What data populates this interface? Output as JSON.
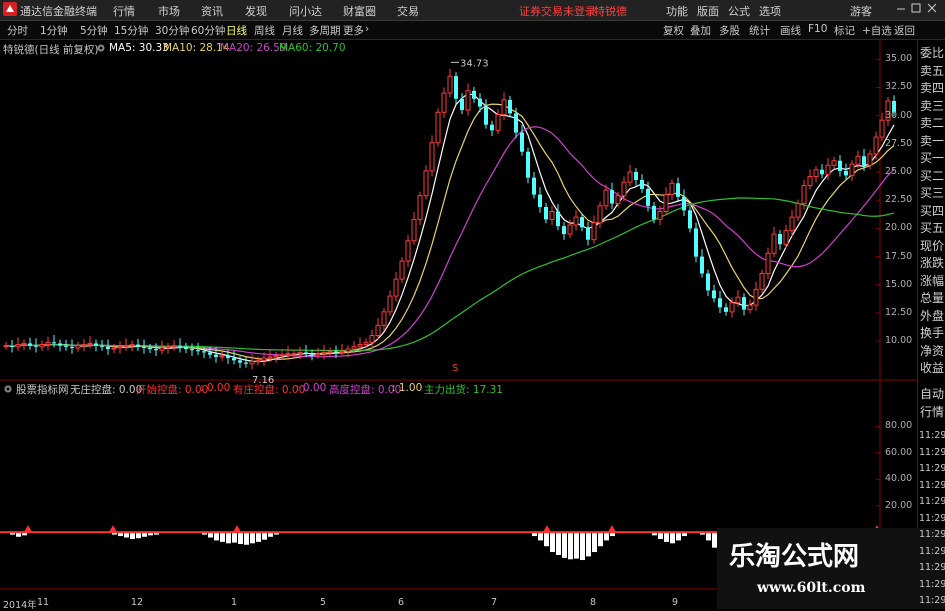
{
  "titlebar": {
    "app_name": "通达信金融终端",
    "menu": [
      "行情",
      "市场",
      "资讯",
      "发现",
      "问小达",
      "财富圈",
      "交易"
    ],
    "notice": "证券交易未登录",
    "stock_name": "特锐德",
    "right_menu": [
      "功能",
      "版面",
      "公式",
      "选项"
    ],
    "guest": "游客",
    "window_controls": [
      "minimize-icon",
      "maximize-icon",
      "close-icon"
    ]
  },
  "toolbar": {
    "periods": [
      "分时",
      "1分钟",
      "5分钟",
      "15分钟",
      "30分钟",
      "60分钟",
      "日线",
      "周线",
      "月线",
      "多周期",
      "更多"
    ],
    "active_period": "日线",
    "right_buttons": [
      "复权",
      "叠加",
      "多股",
      "统计",
      "画线",
      "F10",
      "标记",
      "+自选",
      "返回"
    ]
  },
  "ma_line": {
    "title": "特锐德(日线 前复权)",
    "ma5": "MA5: 30.33",
    "ma10": "MA10: 28.14",
    "ma20": "MA20: 26.59",
    "ma60": "MA60: 20.70",
    "colors": {
      "ma5": "#ffffff",
      "ma10": "#e8d36a",
      "ma20": "#d040d0",
      "ma60": "#30c030"
    }
  },
  "side_panel": {
    "main_items": [
      "委比",
      "卖五",
      "卖四",
      "卖三",
      "卖二",
      "卖一",
      "买一",
      "买二",
      "买三",
      "买四",
      "买五",
      "现价",
      "涨跌",
      "涨幅",
      "总量",
      "外盘",
      "换手",
      "净资",
      "收益"
    ],
    "lower_items": [
      "自动",
      "行情"
    ],
    "times": [
      "11:29",
      "11:29",
      "11:29",
      "11:29",
      "11:29",
      "11:29",
      "11:29",
      "11:29",
      "11:29",
      "11:29",
      "11:29"
    ]
  },
  "indicator_line": {
    "name": "股票指标网",
    "p1": "无庄控盘: 0.00",
    "p2": "开始控盘: 0.00",
    "p2b": ": 0.00",
    "p3": "有庄控盘: 0.00",
    "p3b": ": 0.00",
    "p4": "高度控盘: 0.00",
    "p4b": ": 1.00",
    "p5": "主力出货: 17.31"
  },
  "watermark": {
    "cn": "乐淘公式网",
    "url": "www.60lt.com"
  },
  "chart_data": [
    {
      "type": "candlestick",
      "title": "特锐德(日线 前复权)",
      "ylim": [
        7,
        36
      ],
      "y_ticks": [
        "35.00",
        "32.50",
        "30.00",
        "27.50",
        "25.00",
        "22.50",
        "20.00",
        "17.50",
        "15.00",
        "12.50",
        "10.00"
      ],
      "annotations": {
        "high": "34.73",
        "low": "7.16",
        "marker": "S"
      },
      "x_labels": [
        "2014年",
        "11",
        "12",
        "1",
        "5",
        "6",
        "7",
        "8",
        "9"
      ],
      "close_series": [
        9.6,
        9.5,
        9.7,
        9.8,
        9.6,
        9.5,
        9.7,
        9.9,
        9.8,
        9.6,
        9.5,
        9.4,
        9.6,
        9.7,
        9.8,
        9.6,
        9.5,
        9.3,
        9.4,
        9.5,
        9.6,
        9.7,
        9.5,
        9.4,
        9.3,
        9.2,
        9.4,
        9.5,
        9.6,
        9.5,
        9.3,
        9.2,
        9.1,
        9.0,
        8.8,
        8.6,
        8.7,
        8.5,
        8.3,
        8.1,
        8.0,
        8.2,
        8.3,
        8.5,
        8.6,
        8.7,
        8.8,
        8.9,
        8.9,
        9.0,
        8.9,
        8.8,
        8.9,
        9.0,
        9.1,
        9.0,
        9.1,
        9.3,
        9.5,
        9.7,
        9.9,
        10.5,
        11.4,
        12.6,
        14.0,
        15.5,
        17.1,
        18.9,
        20.8,
        22.9,
        25.1,
        27.6,
        30.3,
        32.0,
        33.5,
        31.5,
        30.5,
        32.2,
        31.5,
        30.8,
        29.2,
        28.7,
        30.1,
        31.4,
        30.2,
        28.5,
        26.8,
        24.5,
        23.0,
        21.9,
        20.8,
        21.5,
        20.2,
        19.5,
        20.3,
        21.0,
        20.1,
        19.0,
        20.5,
        22.0,
        23.4,
        22.2,
        22.9,
        24.1,
        25.0,
        24.3,
        23.5,
        22.0,
        20.8,
        21.5,
        23.0,
        24.0,
        22.8,
        21.6,
        20.0,
        17.5,
        16.0,
        14.5,
        13.8,
        13.0,
        12.6,
        13.4,
        13.9,
        12.8,
        13.2,
        14.6,
        16.0,
        17.8,
        19.5,
        18.6,
        19.8,
        21.0,
        22.2,
        23.8,
        24.6,
        25.2,
        24.8,
        25.6,
        26.0,
        25.1,
        24.7,
        25.7,
        26.4,
        25.6,
        26.6,
        28.1,
        29.6,
        31.3,
        30.3
      ],
      "ma_series": [
        "MA5",
        "MA10",
        "MA20",
        "MA60"
      ]
    },
    {
      "type": "bar",
      "title": "股票指标网",
      "ylim": [
        -40,
        100
      ],
      "y_ticks": [
        "80.00",
        "60.00",
        "40.00",
        "20.00"
      ],
      "series": [
        {
          "name": "主力出货",
          "values": [
            0,
            2,
            5,
            3,
            0,
            0,
            0,
            0,
            0,
            0,
            0,
            0,
            0,
            0,
            0,
            0,
            0,
            0,
            2,
            4,
            6,
            8,
            7,
            5,
            3,
            2,
            0,
            0,
            0,
            0,
            0,
            0,
            0,
            2,
            6,
            10,
            12,
            14,
            13,
            15,
            16,
            14,
            12,
            9,
            5,
            2,
            0,
            0,
            0,
            0,
            0,
            0,
            0,
            0,
            0,
            0,
            0,
            0,
            0,
            0,
            0,
            0,
            0,
            0,
            0,
            0,
            0,
            0,
            0,
            0,
            0,
            0,
            0,
            0,
            0,
            0,
            0,
            0,
            0,
            0,
            0,
            0,
            0,
            0,
            0,
            0,
            0,
            0,
            4,
            10,
            18,
            26,
            30,
            34,
            36,
            35,
            37,
            32,
            26,
            18,
            10,
            4,
            0,
            0,
            0,
            0,
            0,
            0,
            3,
            8,
            12,
            14,
            10,
            4,
            0,
            0,
            2,
            10,
            20,
            28,
            34,
            40,
            42,
            41,
            38,
            33,
            28,
            20,
            12,
            6,
            2,
            0,
            0,
            0,
            0,
            0,
            0,
            0,
            0,
            0,
            0,
            0,
            0,
            0,
            0,
            0,
            0,
            0,
            0
          ]
        }
      ]
    }
  ]
}
